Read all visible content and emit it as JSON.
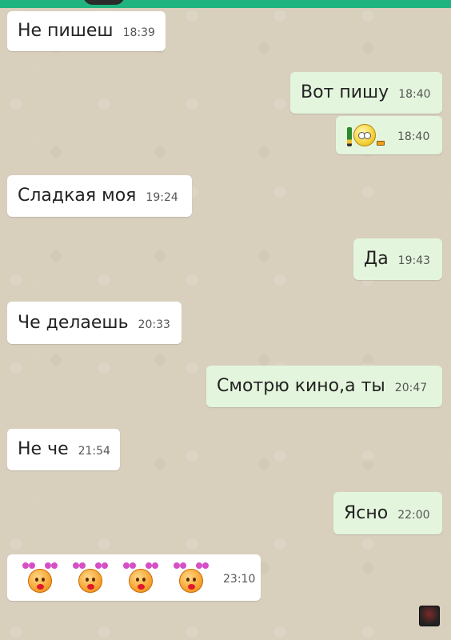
{
  "messages": [
    {
      "dir": "in",
      "text": "Не пишеш",
      "time": "18:39"
    },
    {
      "dir": "out",
      "text": "Вот пишу",
      "time": "18:40"
    },
    {
      "dir": "out",
      "sticker": "pencil-smiley-sticker",
      "time": "18:40"
    },
    {
      "dir": "in",
      "text": "Сладкая моя",
      "time": "19:24"
    },
    {
      "dir": "out",
      "text": "Да",
      "time": "19:43"
    },
    {
      "dir": "in",
      "text": "Че делаешь",
      "time": "20:33"
    },
    {
      "dir": "out",
      "text": "Смотрю кино,а ты",
      "time": "20:47"
    },
    {
      "dir": "in",
      "text": "Не че",
      "time": "21:54"
    },
    {
      "dir": "out",
      "text": "Ясно",
      "time": "22:00"
    },
    {
      "dir": "in",
      "stickers": [
        "kiss-smiley-icon",
        "kiss-smiley-icon",
        "kiss-smiley-icon",
        "kiss-smiley-icon"
      ],
      "time": "23:10"
    }
  ],
  "colors": {
    "header": "#1fb47f",
    "incoming_bubble": "#ffffff",
    "outgoing_bubble": "#e4f5dd",
    "wallpaper": "#d8cfbd"
  }
}
